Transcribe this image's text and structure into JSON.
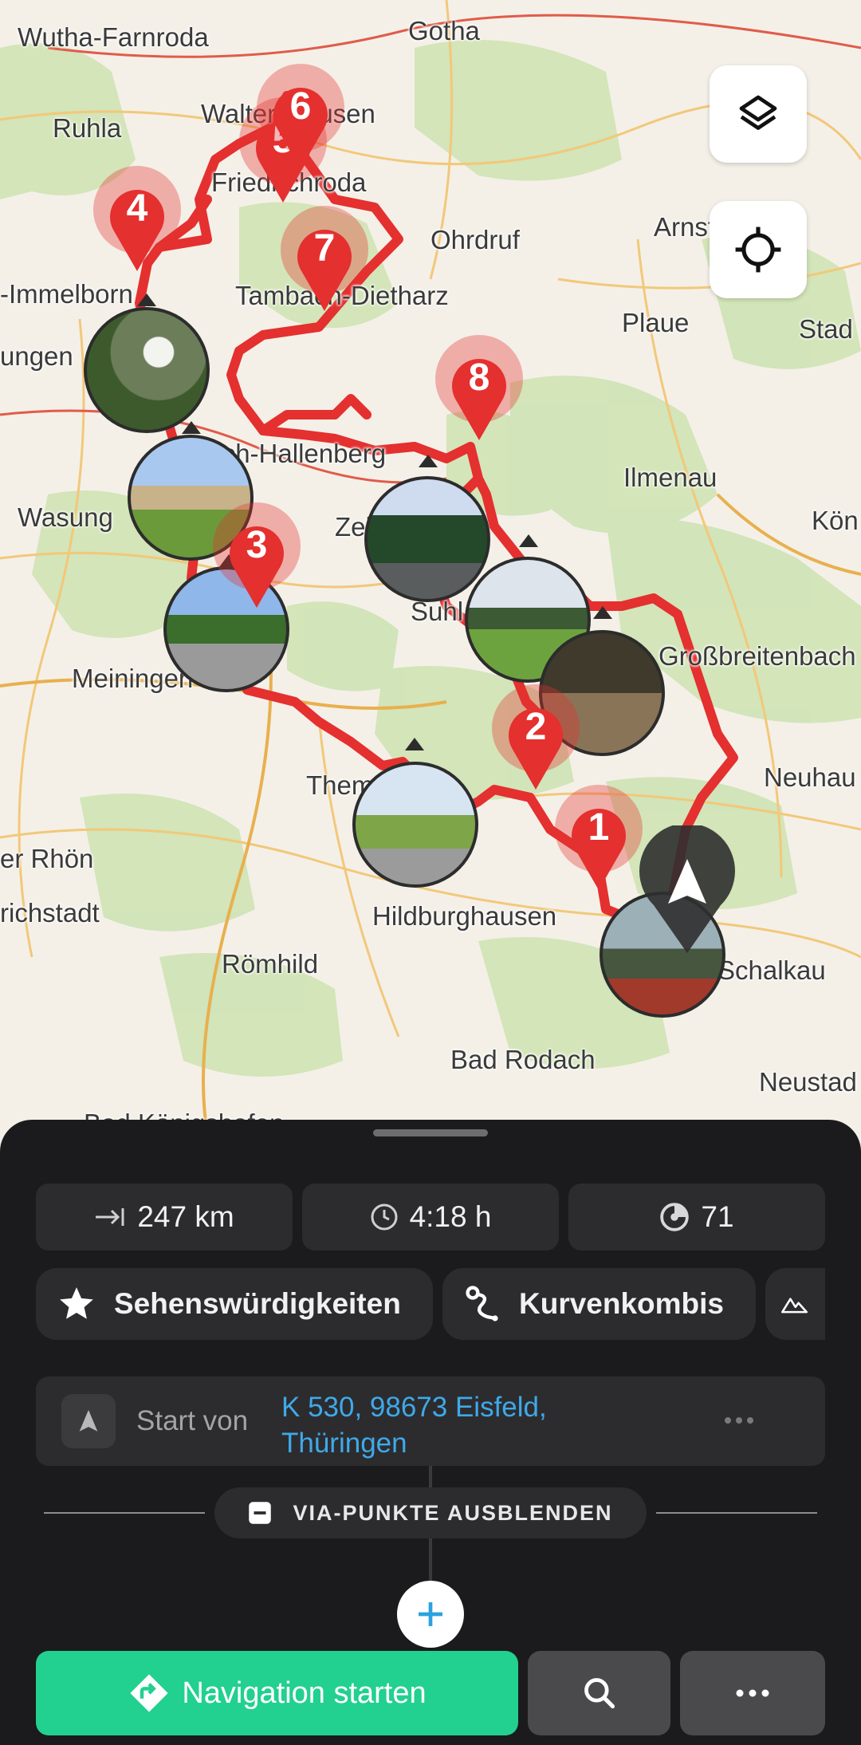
{
  "map": {
    "places": [
      {
        "name": "Wutha-Farnroda"
      },
      {
        "name": "Gotha"
      },
      {
        "name": "Ruhla"
      },
      {
        "name": "Waltershausen"
      },
      {
        "name": "Friedrichroda"
      },
      {
        "name": "Ohrdruf"
      },
      {
        "name": "Arnstadt"
      },
      {
        "name": "-Immelborn"
      },
      {
        "name": "Tambach-Dietharz"
      },
      {
        "name": "Plaue"
      },
      {
        "name": "Stad"
      },
      {
        "name": "ungen"
      },
      {
        "name": "bach-Hallenberg"
      },
      {
        "name": "Ilmenau"
      },
      {
        "name": "Wasung"
      },
      {
        "name": "Kön"
      },
      {
        "name": "Zella-Mehlis"
      },
      {
        "name": "Suhl"
      },
      {
        "name": "Meiningen"
      },
      {
        "name": "Großbreitenbach"
      },
      {
        "name": "Themar"
      },
      {
        "name": "Neuhau"
      },
      {
        "name": "er Rhön"
      },
      {
        "name": "richstadt"
      },
      {
        "name": "Hildburghausen"
      },
      {
        "name": "Römhild"
      },
      {
        "name": "Schalkau"
      },
      {
        "name": "Bad Rodach"
      },
      {
        "name": "Neustad"
      },
      {
        "name": "Bad Königshofen"
      }
    ],
    "pins": [
      "1",
      "2",
      "3",
      "4",
      "5",
      "6",
      "7",
      "8"
    ],
    "route_color": "#e4302f",
    "layers_button": "layers-icon",
    "locate_button": "crosshair-icon"
  },
  "stats": {
    "distance": "247 km",
    "duration": "4:18 h",
    "curviness": "71"
  },
  "filters": [
    {
      "label": "Sehenswürdigkeiten",
      "icon": "star-icon"
    },
    {
      "label": "Kurvenkombis",
      "icon": "curve-icon"
    },
    {
      "label": "",
      "icon": "mountain-icon"
    }
  ],
  "start": {
    "label": "Start von",
    "address": "K 530, 98673 Eisfeld,",
    "address_line2": "Thüringen"
  },
  "via_toggle": "VIA-PUNKTE AUSBLENDEN",
  "actions": {
    "navigate": "Navigation starten",
    "accent": "#22d08f"
  }
}
